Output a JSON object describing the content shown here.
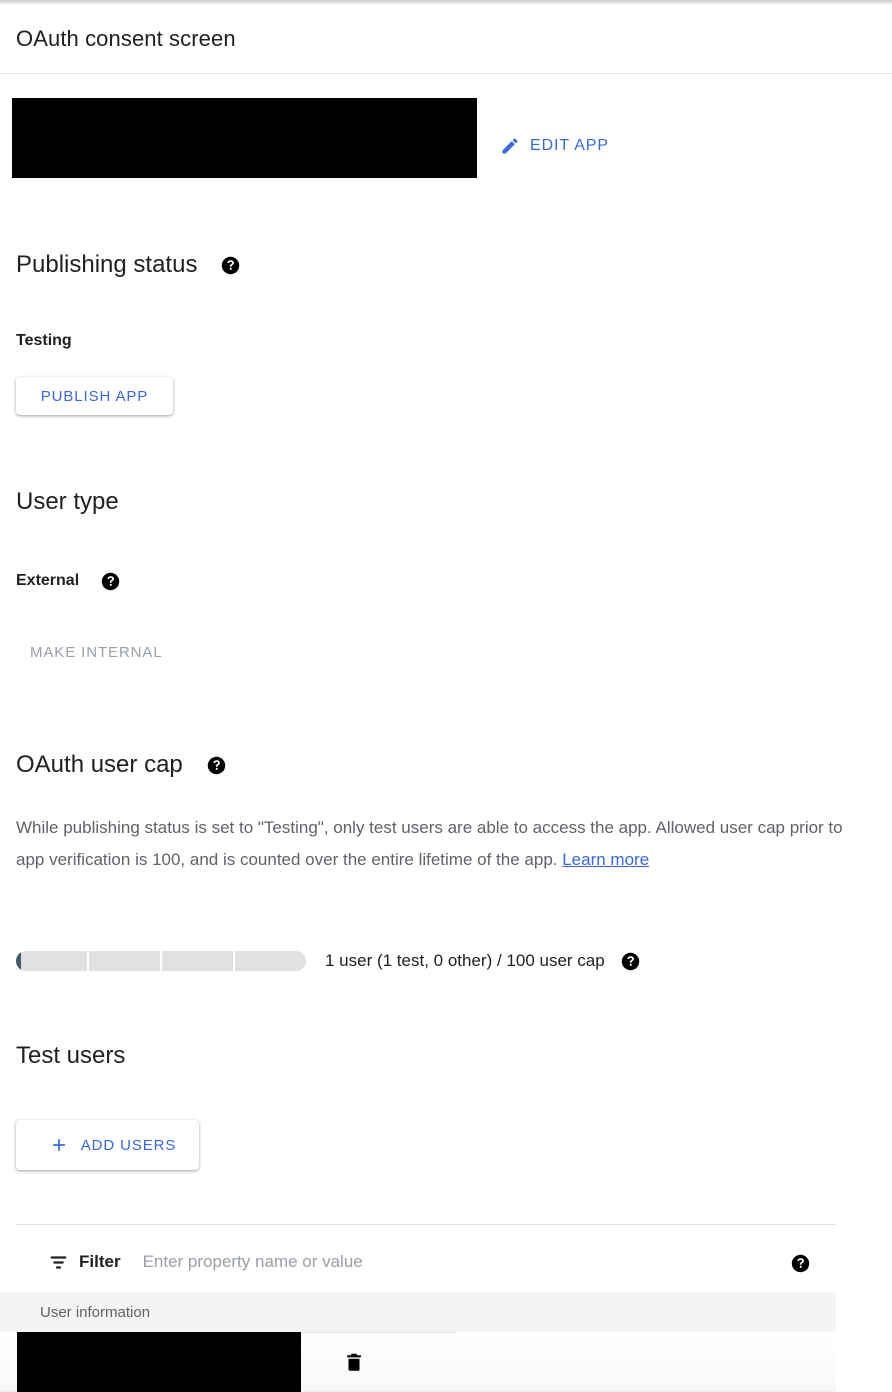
{
  "header": {
    "title": "OAuth consent screen"
  },
  "app": {
    "name_redacted": "",
    "edit_button_label": "EDIT APP",
    "edit_icon": "pencil-icon"
  },
  "publishing_status": {
    "heading": "Publishing status",
    "help_icon": "help-icon",
    "value": "Testing",
    "publish_button_label": "PUBLISH APP"
  },
  "user_type": {
    "heading": "User type",
    "value": "External",
    "help_icon": "help-icon",
    "make_internal_label": "MAKE INTERNAL"
  },
  "oauth_user_cap": {
    "heading": "OAuth user cap",
    "help_icon": "help-icon",
    "description_part1": "While publishing status is set to \"Testing\", only test users are able to access the app. Allowed user cap prior to app verification is 100, and is counted over the entire lifetime of the app. ",
    "learn_more_label": "Learn more",
    "cap_text": "1 user (1 test, 0 other) / 100 user cap",
    "users_used": 1,
    "test_users": 1,
    "other_users": 0,
    "user_cap": 100,
    "progress_segments": 4
  },
  "test_users": {
    "heading": "Test users",
    "add_users_label": "ADD USERS",
    "add_icon": "plus-icon"
  },
  "filter": {
    "icon": "filter-list-icon",
    "label": "Filter",
    "placeholder": "Enter property name or value",
    "value": "",
    "help_icon": "help-icon"
  },
  "table": {
    "columns": [
      "User information"
    ],
    "rows": [
      {
        "user_information_redacted": "",
        "delete_icon": "trash-icon"
      }
    ]
  },
  "colors": {
    "accent_blue": "#3b68d4",
    "text_primary": "#202124",
    "text_secondary": "#5f6368",
    "text_disabled": "#9aa0a6",
    "progress_fill": "#465a65",
    "progress_track": "#dfe1e3",
    "table_header_bg": "#f4f4f4",
    "divider": "#e0e0e0",
    "redaction": "#000000"
  }
}
